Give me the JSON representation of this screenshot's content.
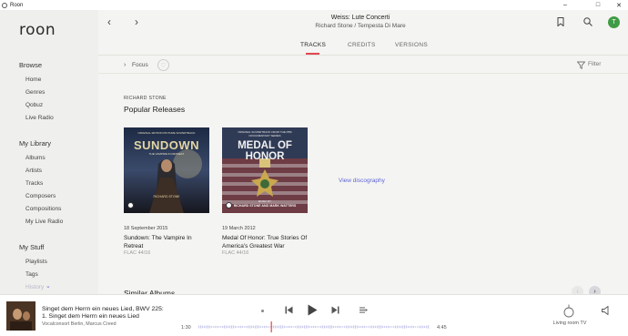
{
  "window": {
    "app_name": "Roon",
    "controls": [
      "minimize",
      "maximize",
      "close"
    ]
  },
  "sidebar": {
    "logo": "roon",
    "browse_heading": "Browse",
    "browse_items": [
      "Home",
      "Genres",
      "Qobuz",
      "Live Radio"
    ],
    "library_heading": "My Library",
    "library_items": [
      "Albums",
      "Artists",
      "Tracks",
      "Composers",
      "Compositions",
      "My Live Radio"
    ],
    "stuff_heading": "My Stuff",
    "stuff_items": [
      "Playlists",
      "Tags",
      "History"
    ]
  },
  "header": {
    "album_title": "Weiss: Lute Concerti",
    "album_subtitle": "Richard Stone / Tempesta Di Mare",
    "avatar_letter": "T",
    "avatar_color": "#3f9b45",
    "icons": [
      "bookmark-icon",
      "search-icon",
      "avatar"
    ]
  },
  "tabs": [
    {
      "label": "TRACKS",
      "active": true
    },
    {
      "label": "CREDITS",
      "active": false
    },
    {
      "label": "VERSIONS",
      "active": false
    }
  ],
  "toolbar": {
    "focus_label": "Focus",
    "filter_label": "Filter"
  },
  "content": {
    "artist_caption": "RICHARD STONE",
    "section_title": "Popular Releases",
    "view_discography": "View discography",
    "similar_title": "Similar Albums",
    "releases": [
      {
        "date": "18 September 2015",
        "title": "Sundown: The Vampire In Retreat",
        "format": "FLAC 44/16",
        "cover_text": "SUNDOWN",
        "cover_top": "ORIGINAL MOTION PICTURE SOUNDTRACK",
        "cover_sub": "THE VAMPIRE IN RETREAT",
        "cover_credit": "RICHARD STONE"
      },
      {
        "date": "19 March 2012",
        "title": "Medal Of Honor: True Stories Of America's Greatest War",
        "format": "FLAC 44/16",
        "cover_top": "ORIGINAL SOUNDTRACK FROM THE PBS DOCUMENTARY SERIES",
        "cover_text": "MEDAL OF HONOR",
        "cover_credit": "RICHARD STONE AND MARK WATTERS",
        "cover_music_by": "MUSIC BY"
      }
    ]
  },
  "player": {
    "title_line1": "Singet dem Herrn ein neues Lied, BWV 225:",
    "title_line2": "1. Singet dem Herrn ein neues Lied",
    "artist": "Vocalconsort Berlin, Marcus Creed",
    "elapsed": "1:30",
    "duration": "4:45",
    "progress": 0.316,
    "zone": "Living room TV",
    "accent_color": "#e0484f",
    "wave_color": "#c9c9ec"
  }
}
